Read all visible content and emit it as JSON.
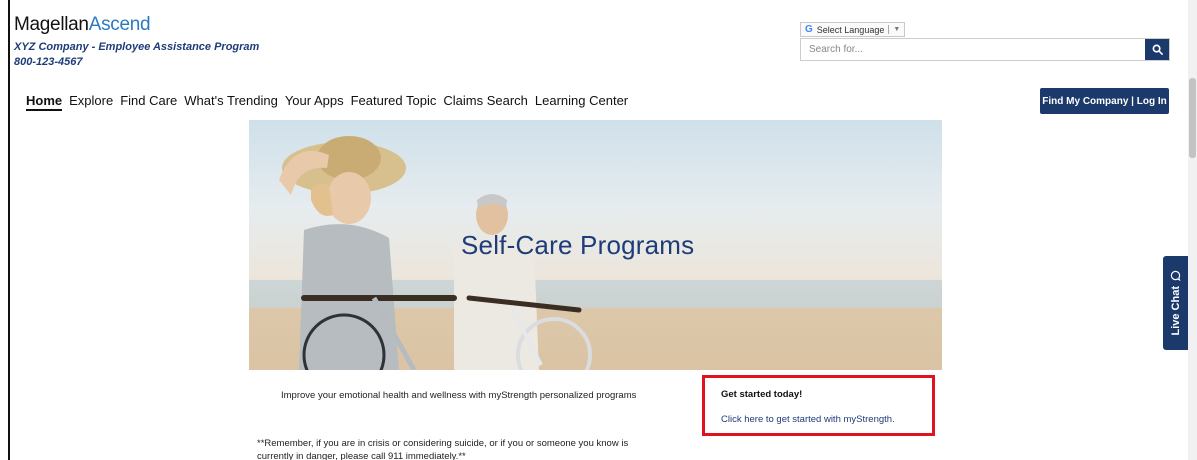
{
  "brand": {
    "logo_main": "Magellan",
    "logo_accent": "Ascend",
    "company": "XYZ Company - Employee Assistance Program",
    "phone": "800-123-4567"
  },
  "translate": {
    "label": "Select Language",
    "icon": "google-g-icon"
  },
  "search": {
    "placeholder": "Search for...",
    "icon": "search-icon"
  },
  "nav": {
    "items": [
      "Home",
      "Explore",
      "Find Care",
      "What's Trending",
      "Your Apps",
      "Featured Topic",
      "Claims Search",
      "Learning Center"
    ],
    "active": "Home"
  },
  "login": {
    "label": "Find My Company | Log In"
  },
  "hero": {
    "title": "Self-Care Programs"
  },
  "content": {
    "intro": "Improve your emotional health and wellness with myStrength personalized programs",
    "cta_heading": "Get started today!",
    "cta_link": "Click here to get started with myStrength.",
    "warning_line1": "**Remember, if you are in crisis or considering suicide, or if you or someone you know is",
    "warning_line2": "currently in danger, please call 911 immediately.**"
  },
  "chat": {
    "label": "Live Chat",
    "icon": "chat-bubble-icon"
  },
  "colors": {
    "brand_navy": "#1b3a6b",
    "accent_blue": "#2a7ac0",
    "highlight_red": "#e0141e"
  }
}
